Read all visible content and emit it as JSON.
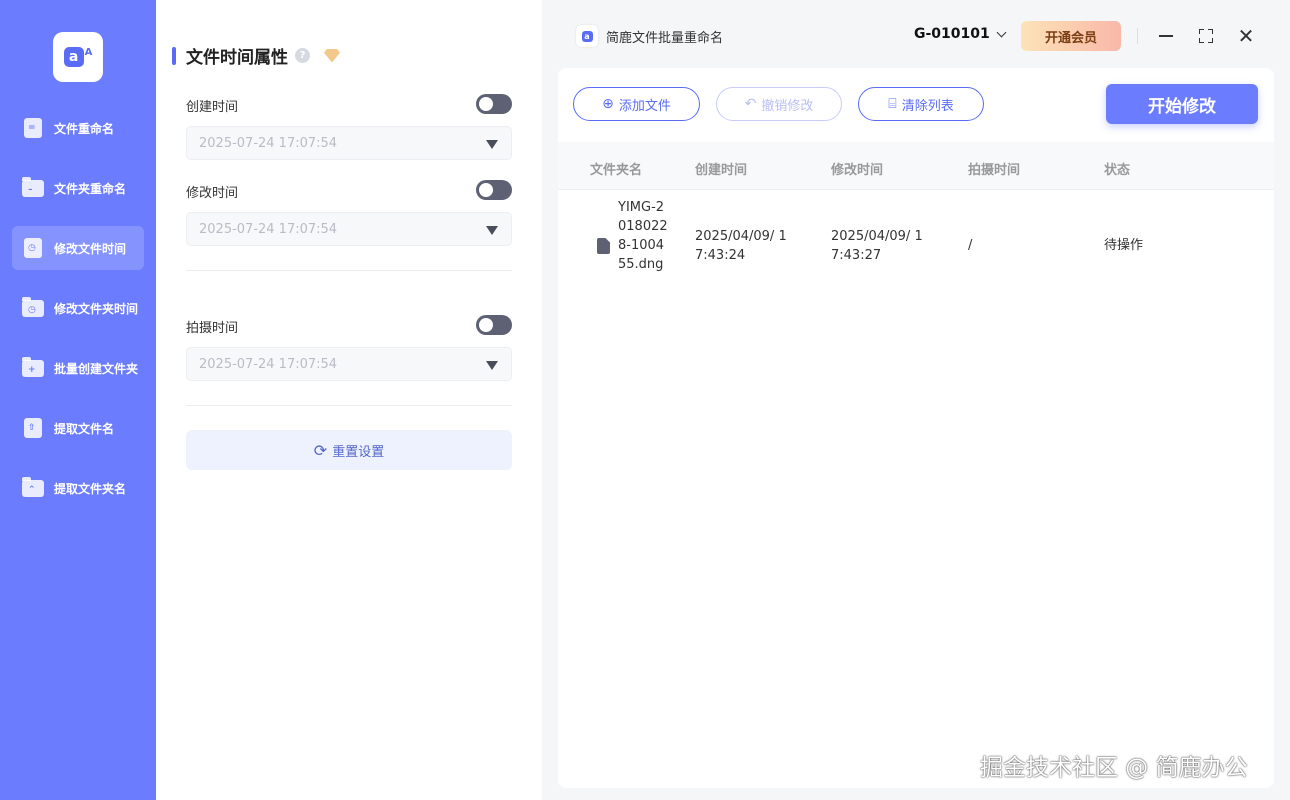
{
  "sidebar": {
    "items": [
      {
        "label": "文件重命名",
        "icon": "doc-icon"
      },
      {
        "label": "文件夹重命名",
        "icon": "folder-icon"
      },
      {
        "label": "修改文件时间",
        "icon": "doc-clock-icon",
        "active": true
      },
      {
        "label": "修改文件夹时间",
        "icon": "folder-clock-icon"
      },
      {
        "label": "批量创建文件夹",
        "icon": "folder-plus-icon"
      },
      {
        "label": "提取文件名",
        "icon": "doc-upload-icon"
      },
      {
        "label": "提取文件夹名",
        "icon": "folder-upload-icon"
      }
    ]
  },
  "settings": {
    "title": "文件时间属性",
    "fields": [
      {
        "label": "创建时间",
        "value": "2025-07-24 17:07:54"
      },
      {
        "label": "修改时间",
        "value": "2025-07-24 17:07:54"
      },
      {
        "label": "拍摄时间",
        "value": "2025-07-24 17:07:54"
      }
    ],
    "reset_label": "重置设置"
  },
  "header": {
    "app_title": "简鹿文件批量重命名",
    "account": "G-010101",
    "vip_label": "开通会员"
  },
  "toolbar": {
    "add_file": "添加文件",
    "undo": "撤销修改",
    "clear": "清除列表",
    "start": "开始修改"
  },
  "table": {
    "columns": [
      "文件夹名",
      "创建时间",
      "修改时间",
      "拍摄时间",
      "状态"
    ],
    "rows": [
      {
        "name": "YIMG-20180228-100455.dng",
        "created": "2025/04/09/ 17:43:24",
        "modified": "2025/04/09/ 17:43:27",
        "shot": "/",
        "status": "待操作"
      }
    ]
  },
  "watermark": "掘金技术社区 @ 简鹿办公",
  "colors": {
    "accent": "#6b7cff",
    "toggle_off": "#5d6173"
  }
}
